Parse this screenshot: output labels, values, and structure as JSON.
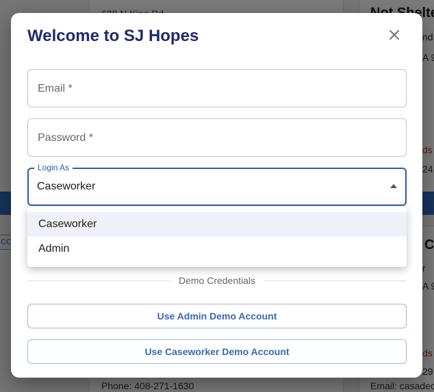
{
  "background": {
    "address_partial": "628 N King Rd",
    "right_heading": "Not Shelte",
    "right_line_1": "nd",
    "right_line_2": "A 9",
    "needs_partial": "ds",
    "phone_partial": "24",
    "chip_label": "CC",
    "right_heading_2": "C",
    "right_line_3": "r",
    "right_line_4": "A 9",
    "needs_partial_2": "ds",
    "phone_partial_2": "29",
    "phone_left": "Phone: 408-271-1630",
    "email_right": "Email: casadec"
  },
  "dialog": {
    "title": "Welcome to SJ Hopes",
    "close_icon": "close-icon",
    "email_label": "Email *",
    "password_label": "Password *",
    "login_as": {
      "label": "Login As",
      "value": "Caseworker",
      "options": [
        "Caseworker",
        "Admin"
      ],
      "selected": "Caseworker"
    },
    "divider_label": "Demo Credentials",
    "admin_demo_button": "Use Admin Demo Account",
    "caseworker_demo_button": "Use Caseworker Demo Account"
  },
  "colors": {
    "title": "#1f2a6e",
    "accent": "#2a5dab",
    "button_text": "#3a68b3"
  }
}
